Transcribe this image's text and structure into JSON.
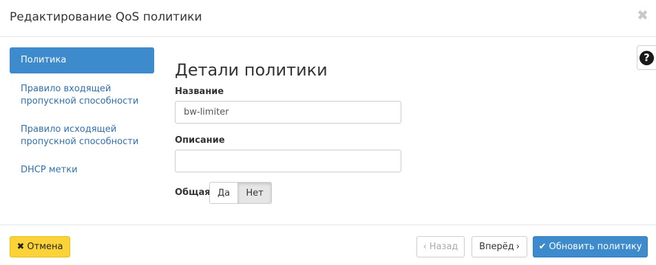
{
  "dialog": {
    "title": "Редактирование QoS политики",
    "close_icon": "close-icon"
  },
  "help": {
    "icon": "question-icon",
    "glyph": "?"
  },
  "nav": {
    "items": [
      {
        "label": "Политика",
        "active": true
      },
      {
        "label": "Правило входящей\nпропускной способности",
        "line1": "Правило входящей",
        "line2": "пропускной способности",
        "active": false
      },
      {
        "label": "Правило исходящей\nпропускной способности",
        "line1": "Правило исходящей",
        "line2": "пропускной способности",
        "active": false
      },
      {
        "label": "DHCP метки",
        "active": false
      }
    ]
  },
  "form": {
    "section_title": "Детали политики",
    "name_label": "Название",
    "name_value": "bw-limiter",
    "description_label": "Описание",
    "description_value": "",
    "shared_label": "Общая",
    "shared_options": [
      "Да",
      "Нет"
    ],
    "shared_selected": "Нет"
  },
  "footer": {
    "cancel_label": "Отмена",
    "cancel_icon": "times-icon",
    "back_label": "Назад",
    "next_label": "Вперёд",
    "submit_label": "Обновить политику",
    "submit_icon": "check-icon"
  },
  "colors": {
    "primary": "#3d8bcd",
    "link": "#2f6fae",
    "warning": "#fbd338"
  }
}
